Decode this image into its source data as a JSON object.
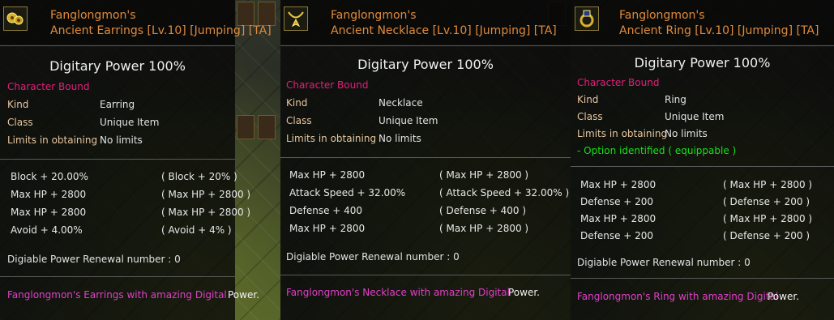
{
  "panels": [
    {
      "item_name": "Fanglongmon's",
      "item_subtitle": "Ancient Earrings [Lv.10] [Jumping] [TA]",
      "icon": "earrings-icon",
      "digitary_power": "Digitary Power 100%",
      "bound": "Character Bound",
      "kind_label": "Kind",
      "kind_value": "Earring",
      "class_label": "Class",
      "class_value": "Unique Item",
      "limits_label": "Limits in obtaining",
      "limits_value": "No limits",
      "option_note": "",
      "stats": [
        {
          "left": "Block + 20.00%",
          "right": "( Block + 20% )"
        },
        {
          "left": "Max HP + 2800",
          "right": "( Max HP + 2800 )"
        },
        {
          "left": "Max HP + 2800",
          "right": "( Max HP + 2800 )"
        },
        {
          "left": "Avoid + 4.00%",
          "right": "( Avoid + 4% )"
        }
      ],
      "renewal": "Digiable Power Renewal number : 0",
      "desc_colored": "Fanglongmon's Earrings with amazing Digital",
      "desc_tail": "Power."
    },
    {
      "item_name": "Fanglongmon's",
      "item_subtitle": "Ancient Necklace [Lv.10] [Jumping] [TA]",
      "icon": "necklace-icon",
      "digitary_power": "Digitary Power 100%",
      "bound": "Character Bound",
      "kind_label": "Kind",
      "kind_value": "Necklace",
      "class_label": "Class",
      "class_value": "Unique Item",
      "limits_label": "Limits in obtaining",
      "limits_value": "No limits",
      "option_note": "",
      "stats": [
        {
          "left": "Max HP + 2800",
          "right": "( Max HP + 2800 )"
        },
        {
          "left": "Attack Speed + 32.00%",
          "right": "( Attack Speed + 32.00% )"
        },
        {
          "left": "Defense + 400",
          "right": "( Defense + 400 )"
        },
        {
          "left": "Max HP + 2800",
          "right": "( Max HP + 2800 )"
        }
      ],
      "renewal": "Digiable Power Renewal number : 0",
      "desc_colored": "Fanglongmon's Necklace with amazing Digital",
      "desc_tail": "Power."
    },
    {
      "item_name": "Fanglongmon's",
      "item_subtitle": "Ancient Ring [Lv.10] [Jumping] [TA]",
      "icon": "ring-icon",
      "digitary_power": "Digitary Power 100%",
      "bound": "Character Bound",
      "kind_label": "Kind",
      "kind_value": "Ring",
      "class_label": "Class",
      "class_value": "Unique Item",
      "limits_label": "Limits in obtaining",
      "limits_value": "No limits",
      "option_note": "- Option identified ( equippable )",
      "stats": [
        {
          "left": "Max HP + 2800",
          "right": "( Max HP + 2800 )"
        },
        {
          "left": "Defense + 200",
          "right": "( Defense + 200 )"
        },
        {
          "left": "Max HP + 2800",
          "right": "( Max HP + 2800 )"
        },
        {
          "left": "Defense + 200",
          "right": "( Defense + 200 )"
        }
      ],
      "renewal": "Digiable Power Renewal number : 0",
      "desc_colored": "Fanglongmon's Ring with amazing Digital",
      "desc_tail": "Power."
    }
  ]
}
